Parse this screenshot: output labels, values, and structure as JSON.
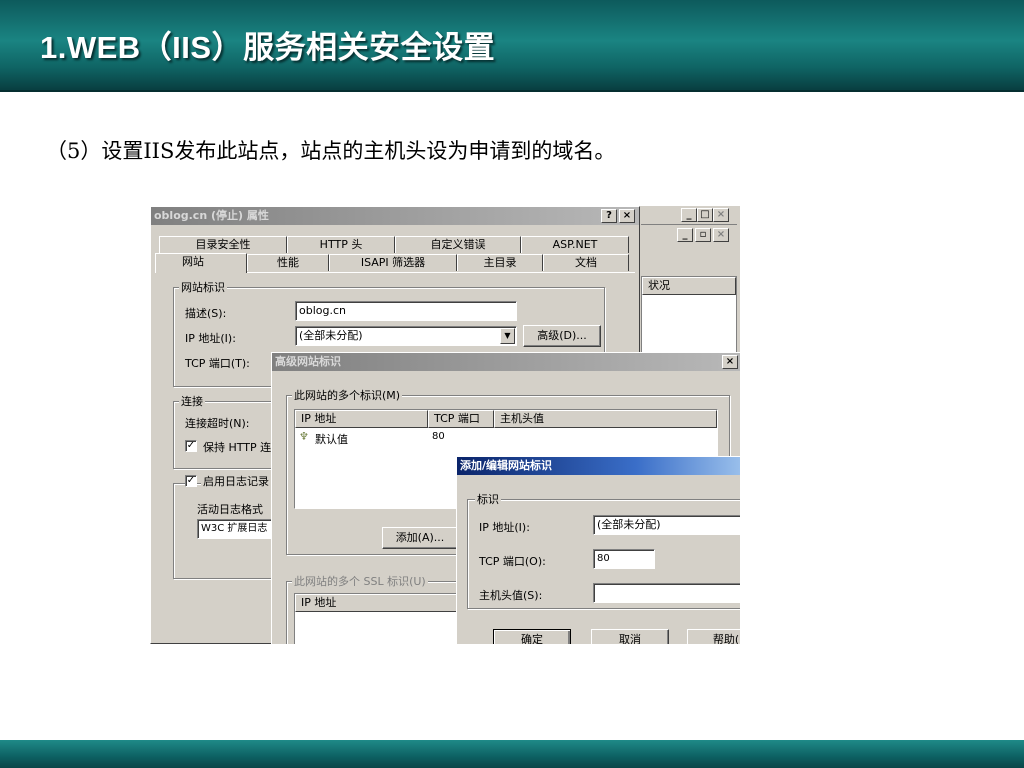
{
  "slide": {
    "title": "1.WEB（IIS）服务相关安全设置",
    "body": "（5）设置IIS发布此站点，站点的主机头设为申请到的域名。"
  },
  "props_dialog": {
    "title": "oblog.cn (停止) 属性",
    "help_btn": "?",
    "close_btn": "×",
    "tabs_row1": [
      "目录安全性",
      "HTTP 头",
      "自定义错误",
      "ASP.NET"
    ],
    "tabs_row2": [
      "网站",
      "性能",
      "ISAPI 筛选器",
      "主目录",
      "文档"
    ],
    "site_group": "网站标识",
    "desc_label": "描述(S):",
    "desc_value": "oblog.cn",
    "ip_label": "IP 地址(I):",
    "ip_value": "(全部未分配)",
    "advanced_btn": "高级(D)...",
    "tcp_label": "TCP 端口(T):",
    "conn_group": "连接",
    "timeout_label": "连接超时(N):",
    "keepalive_label": "保持 HTTP 连",
    "logging_label": "启用日志记录",
    "active_log_label": "活动日志格式",
    "log_format": "W3C 扩展日志"
  },
  "bg_window": {
    "min_btn": "_",
    "max_btn": "□",
    "close_btn": "×",
    "restore_btn": "▫",
    "status_header": "状况"
  },
  "advanced_dialog": {
    "title": "高级网站标识",
    "close_btn": "×",
    "multi_group": "此网站的多个标识(M)",
    "col_ip": "IP 地址",
    "col_port": "TCP 端口",
    "col_host": "主机头值",
    "row_ip": "默认值",
    "row_port": "80",
    "add_btn": "添加(A)...",
    "ssl_group": "此网站的多个 SSL 标识(U)",
    "ssl_col_ip": "IP 地址"
  },
  "edit_dialog": {
    "title": "添加/编辑网站标识",
    "group": "标识",
    "ip_label": "IP 地址(I):",
    "ip_value": "(全部未分配)",
    "tcp_label": "TCP 端口(O):",
    "tcp_value": "80",
    "host_label": "主机头值(S):",
    "host_value": "",
    "ok_btn": "确定",
    "cancel_btn": "取消",
    "help_btn": "帮助("
  },
  "colors": {
    "header_teal": "#1a8482",
    "footer_teal": "#0d6062",
    "dialog_face": "#d4d0c8",
    "title_active": "#0a246a",
    "title_inactive": "#808080"
  }
}
